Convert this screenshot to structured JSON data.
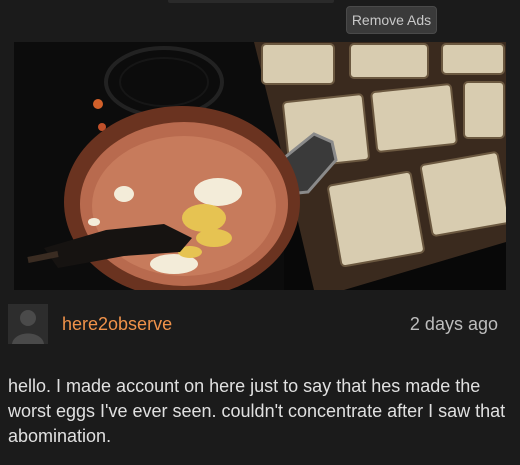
{
  "header": {
    "remove_ads_label": "Remove Ads"
  },
  "video": {
    "thumbnail_icon": "video-frame"
  },
  "comment": {
    "username": "here2observe",
    "timestamp": "2 days ago",
    "text": "hello. I made account on here just to say that hes made the worst eggs I've ever seen. couldn't concentrate after I saw that abomination.",
    "avatar_icon": "default-user-avatar"
  },
  "colors": {
    "username": "#f0924a",
    "background": "#1b1b1b"
  }
}
